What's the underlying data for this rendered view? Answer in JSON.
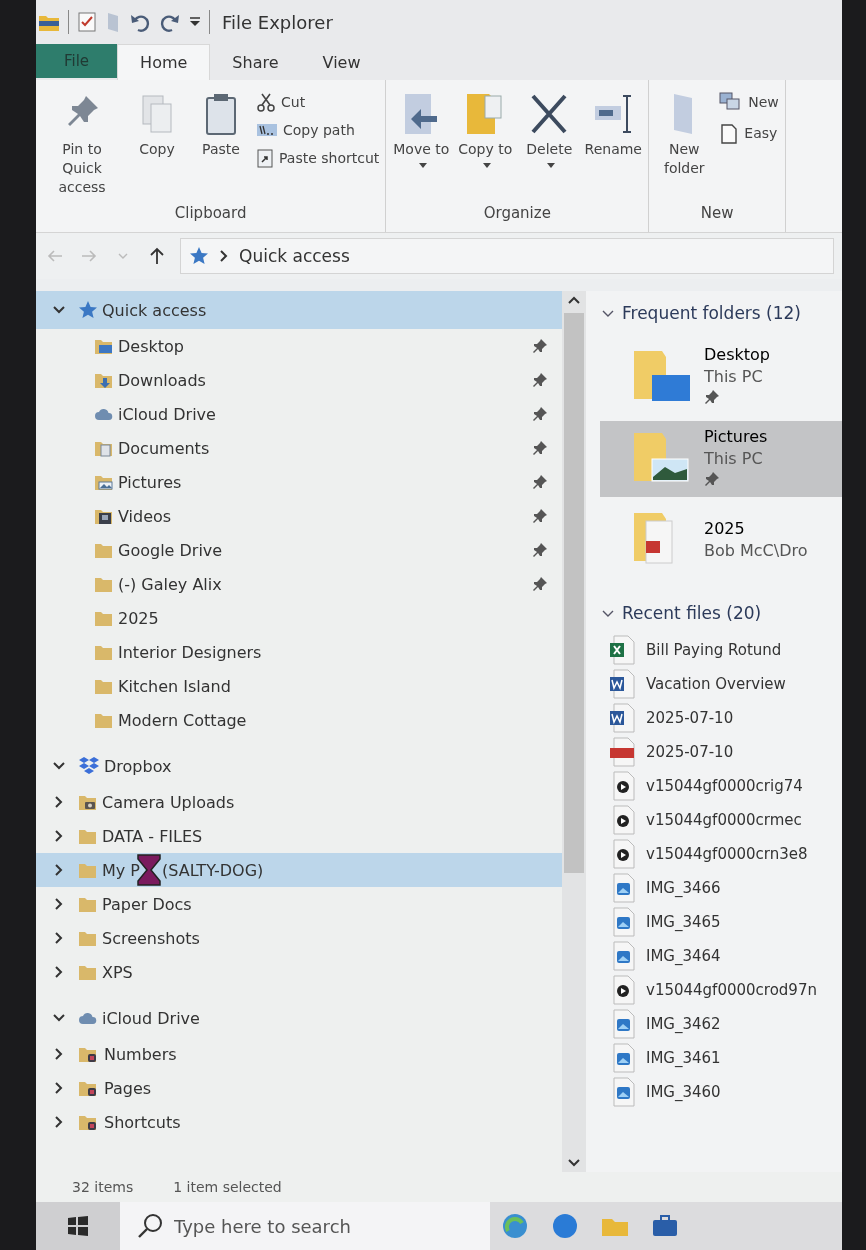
{
  "window": {
    "title": "File Explorer"
  },
  "tabs": [
    {
      "label": "File",
      "kind": "file",
      "selected": false
    },
    {
      "label": "Home",
      "kind": "tab",
      "selected": true
    },
    {
      "label": "Share",
      "kind": "tab",
      "selected": false
    },
    {
      "label": "View",
      "kind": "tab",
      "selected": false
    }
  ],
  "ribbon": {
    "groups": [
      {
        "label": "Clipboard",
        "large": [
          {
            "label": "Pin to Quick access",
            "kind": "pin",
            "dropdown": false
          },
          {
            "label": "Copy",
            "kind": "copy",
            "dropdown": false
          },
          {
            "label": "Paste",
            "kind": "paste",
            "dropdown": false
          }
        ],
        "small": [
          {
            "label": "Cut",
            "kind": "cut"
          },
          {
            "label": "Copy path",
            "kind": "copypath"
          },
          {
            "label": "Paste shortcut",
            "kind": "pasteshortcut"
          }
        ]
      },
      {
        "label": "Organize",
        "large": [
          {
            "label": "Move to",
            "kind": "move",
            "dropdown": true
          },
          {
            "label": "Copy to",
            "kind": "copyto",
            "dropdown": true
          },
          {
            "label": "Delete",
            "kind": "delete",
            "dropdown": true
          },
          {
            "label": "Rename",
            "kind": "rename",
            "dropdown": false
          }
        ]
      },
      {
        "label": "New",
        "large": [
          {
            "label": "New folder",
            "kind": "newfolder",
            "dropdown": false
          }
        ],
        "small": [
          {
            "label": "New",
            "kind": "newitem"
          },
          {
            "label": "Easy",
            "kind": "easyaccess"
          }
        ]
      }
    ]
  },
  "address_bar": {
    "path": "Quick access"
  },
  "nav_tree": [
    {
      "label": "Quick access",
      "kind": "star",
      "expanded": true,
      "selected": true,
      "children": [
        {
          "label": "Desktop",
          "kind": "desktop",
          "pinned": true,
          "selected": false
        },
        {
          "label": "Downloads",
          "kind": "downloads",
          "pinned": true,
          "selected": false
        },
        {
          "label": "iCloud Drive",
          "kind": "cloud",
          "pinned": true,
          "selected": false
        },
        {
          "label": "Documents",
          "kind": "documents",
          "pinned": true,
          "selected": false
        },
        {
          "label": "Pictures",
          "kind": "pictures",
          "pinned": true,
          "selected": false
        },
        {
          "label": "Videos",
          "kind": "videos",
          "pinned": true,
          "selected": false
        },
        {
          "label": "Google Drive",
          "kind": "folder",
          "pinned": true,
          "selected": false
        },
        {
          "label": "(-) Galey Alix",
          "kind": "folder",
          "pinned": true,
          "selected": false
        },
        {
          "label": "2025",
          "kind": "folder",
          "pinned": false,
          "selected": false
        },
        {
          "label": "Interior Designers",
          "kind": "folder",
          "pinned": false,
          "selected": false
        },
        {
          "label": "Kitchen Island",
          "kind": "folder",
          "pinned": false,
          "selected": false
        },
        {
          "label": "Modern Cottage",
          "kind": "folder",
          "pinned": false,
          "selected": false
        }
      ]
    },
    {
      "label": "Dropbox",
      "kind": "dropbox",
      "expanded": true,
      "selected": false,
      "children": [
        {
          "label": "Camera Uploads",
          "kind": "camera",
          "expanded": false,
          "selected": false
        },
        {
          "label": "DATA - FILES",
          "kind": "folder",
          "expanded": false,
          "selected": false
        },
        {
          "label": "My P",
          "label_after": "(SALTY-DOG)",
          "busy_cursor": true,
          "kind": "folder",
          "expanded": false,
          "selected": true
        },
        {
          "label": "Paper Docs",
          "kind": "folder",
          "expanded": false,
          "selected": false
        },
        {
          "label": "Screenshots",
          "kind": "folder",
          "expanded": false,
          "selected": false
        },
        {
          "label": "XPS",
          "kind": "folder",
          "expanded": false,
          "selected": false
        }
      ]
    },
    {
      "label": "iCloud Drive",
      "kind": "cloud",
      "expanded": true,
      "selected": false,
      "children": [
        {
          "label": "Numbers",
          "kind": "app",
          "expanded": false,
          "selected": false
        },
        {
          "label": "Pages",
          "kind": "app",
          "expanded": false,
          "selected": false
        },
        {
          "label": "Shortcuts",
          "kind": "app",
          "expanded": false,
          "selected": false
        }
      ]
    }
  ],
  "content": {
    "sections": [
      {
        "title": "Frequent folders (12)",
        "kind": "tiles",
        "expanded": true,
        "items": [
          {
            "name": "Desktop",
            "location": "This PC",
            "kind": "desktop",
            "pinned": true,
            "selected": false
          },
          {
            "name": "Pictures",
            "location": "This PC",
            "kind": "pictures",
            "pinned": true,
            "selected": true
          },
          {
            "name": "2025",
            "location": "Bob McC\\Dro",
            "kind": "documents",
            "pinned": false,
            "selected": false
          }
        ]
      },
      {
        "title": "Recent files (20)",
        "kind": "list",
        "expanded": true,
        "items": [
          {
            "name": "Bill Paying Rotund",
            "kind": "excel"
          },
          {
            "name": "Vacation Overview",
            "kind": "word"
          },
          {
            "name": "2025-07-10",
            "kind": "word"
          },
          {
            "name": "2025-07-10",
            "kind": "pdf"
          },
          {
            "name": "v15044gf0000crig74",
            "kind": "video"
          },
          {
            "name": "v15044gf0000crmec",
            "kind": "video"
          },
          {
            "name": "v15044gf0000crn3e8",
            "kind": "video"
          },
          {
            "name": "IMG_3466",
            "kind": "image"
          },
          {
            "name": "IMG_3465",
            "kind": "image"
          },
          {
            "name": "IMG_3464",
            "kind": "image"
          },
          {
            "name": "v15044gf0000crod97n",
            "kind": "video"
          },
          {
            "name": "IMG_3462",
            "kind": "image"
          },
          {
            "name": "IMG_3461",
            "kind": "image"
          },
          {
            "name": "IMG_3460",
            "kind": "image"
          }
        ]
      }
    ]
  },
  "status_bar": {
    "items": [
      "32 items",
      "1 item selected"
    ]
  },
  "taskbar": {
    "search": {
      "placeholder": "Type here to search"
    }
  }
}
